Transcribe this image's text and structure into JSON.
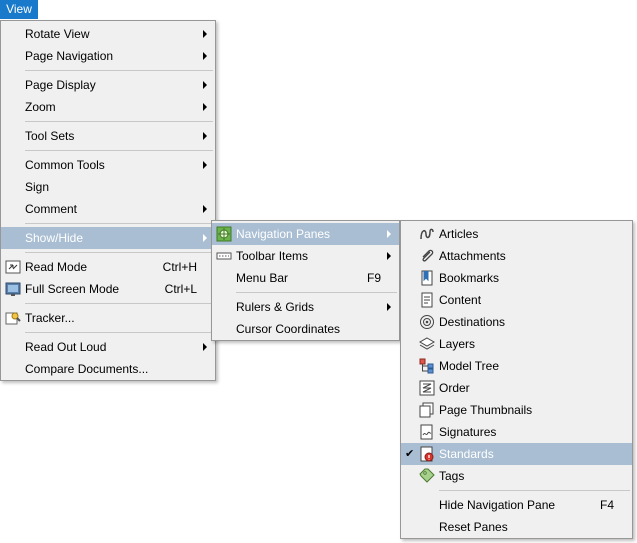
{
  "menubar": {
    "view_label": "View"
  },
  "view_menu": {
    "rotate_view": "Rotate View",
    "page_navigation": "Page Navigation",
    "page_display": "Page Display",
    "zoom": "Zoom",
    "tool_sets": "Tool Sets",
    "common_tools": "Common Tools",
    "sign": "Sign",
    "comment": "Comment",
    "show_hide": "Show/Hide",
    "read_mode": "Read Mode",
    "read_mode_shortcut": "Ctrl+H",
    "full_screen_mode": "Full Screen Mode",
    "full_screen_shortcut": "Ctrl+L",
    "tracker": "Tracker...",
    "read_out_loud": "Read Out Loud",
    "compare_documents": "Compare Documents..."
  },
  "show_hide_menu": {
    "navigation_panes": "Navigation Panes",
    "toolbar_items": "Toolbar Items",
    "menu_bar": "Menu Bar",
    "menu_bar_shortcut": "F9",
    "rulers_grids": "Rulers & Grids",
    "cursor_coordinates": "Cursor Coordinates"
  },
  "navigation_panes_menu": {
    "articles": "Articles",
    "attachments": "Attachments",
    "bookmarks": "Bookmarks",
    "content": "Content",
    "destinations": "Destinations",
    "layers": "Layers",
    "model_tree": "Model Tree",
    "order": "Order",
    "page_thumbnails": "Page Thumbnails",
    "signatures": "Signatures",
    "standards": "Standards",
    "standards_checked": "✔",
    "tags": "Tags",
    "hide_navigation_pane": "Hide Navigation Pane",
    "hide_navigation_pane_shortcut": "F4",
    "reset_panes": "Reset Panes"
  },
  "colors": {
    "menubar_active": "#1979ca",
    "menu_background": "#f0f0f0",
    "highlight": "#a9bed3"
  }
}
